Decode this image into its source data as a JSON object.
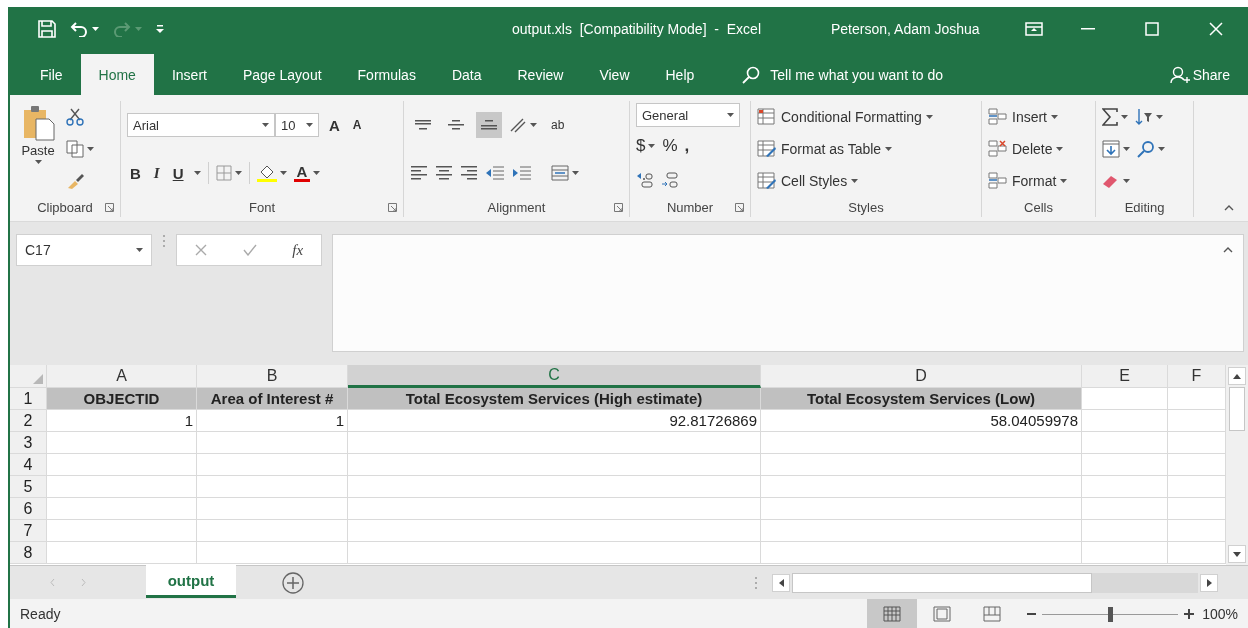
{
  "window": {
    "title": "output.xls  [Compatibility Mode]  -  Excel",
    "user": "Peterson, Adam Joshua"
  },
  "ribbon_tabs": [
    {
      "label": "File",
      "selected": false
    },
    {
      "label": "Home",
      "selected": true
    },
    {
      "label": "Insert",
      "selected": false
    },
    {
      "label": "Page Layout",
      "selected": false
    },
    {
      "label": "Formulas",
      "selected": false
    },
    {
      "label": "Data",
      "selected": false
    },
    {
      "label": "Review",
      "selected": false
    },
    {
      "label": "View",
      "selected": false
    },
    {
      "label": "Help",
      "selected": false
    }
  ],
  "tell_me": {
    "placeholder": "Tell me what you want to do"
  },
  "share": "Share",
  "ribbon": {
    "clipboard": {
      "paste": "Paste",
      "label": "Clipboard"
    },
    "font": {
      "name": "Arial",
      "size": "10",
      "grow": "A",
      "shrink": "A",
      "styles": [
        "B",
        "I",
        "U"
      ],
      "color_letter": "A",
      "label": "Font"
    },
    "alignment": {
      "vertical": [
        {
          "kind": "top",
          "selected": false
        },
        {
          "kind": "middle",
          "selected": false
        },
        {
          "kind": "bottom",
          "selected": true
        }
      ],
      "wrap": "ab",
      "label": "Alignment"
    },
    "number": {
      "format": "General",
      "symbols": [
        "$",
        "%",
        ","
      ],
      "label": "Number"
    },
    "styles": {
      "buttons": [
        "Conditional Formatting",
        "Format as Table",
        "Cell Styles"
      ],
      "label": "Styles"
    },
    "cells": {
      "buttons": [
        "Insert",
        "Delete",
        "Format"
      ],
      "label": "Cells"
    },
    "editing": {
      "label": "Editing"
    }
  },
  "formula_bar": {
    "name_box": "C17",
    "fx": "fx"
  },
  "sheet": {
    "columns": [
      {
        "label": "A",
        "selected": false
      },
      {
        "label": "B",
        "selected": false
      },
      {
        "label": "C",
        "selected": true
      },
      {
        "label": "D",
        "selected": false
      },
      {
        "label": "E",
        "selected": false
      },
      {
        "label": "F",
        "selected": false
      }
    ],
    "rows": [
      {
        "number": "1",
        "kind": "header",
        "cells": [
          "OBJECTID",
          "Area of Interest #",
          "Total Ecosystem Services (High estimate)",
          "Total Ecosystem Services (Low)"
        ]
      },
      {
        "number": "2",
        "kind": "data",
        "cells": [
          "1",
          "1",
          "92.81726869",
          "58.04059978"
        ]
      },
      {
        "number": "3"
      },
      {
        "number": "4"
      },
      {
        "number": "5"
      },
      {
        "number": "6"
      },
      {
        "number": "7"
      },
      {
        "number": "8"
      }
    ]
  },
  "sheet_tabs": [
    {
      "label": "output",
      "selected": true
    }
  ],
  "status_bar": {
    "text": "Ready",
    "views": [
      {
        "kind": "normal",
        "selected": true
      },
      {
        "kind": "page_layout",
        "selected": false
      },
      {
        "kind": "page_break",
        "selected": false
      }
    ],
    "zoom": {
      "level": 0.5,
      "reading": "100%"
    }
  }
}
